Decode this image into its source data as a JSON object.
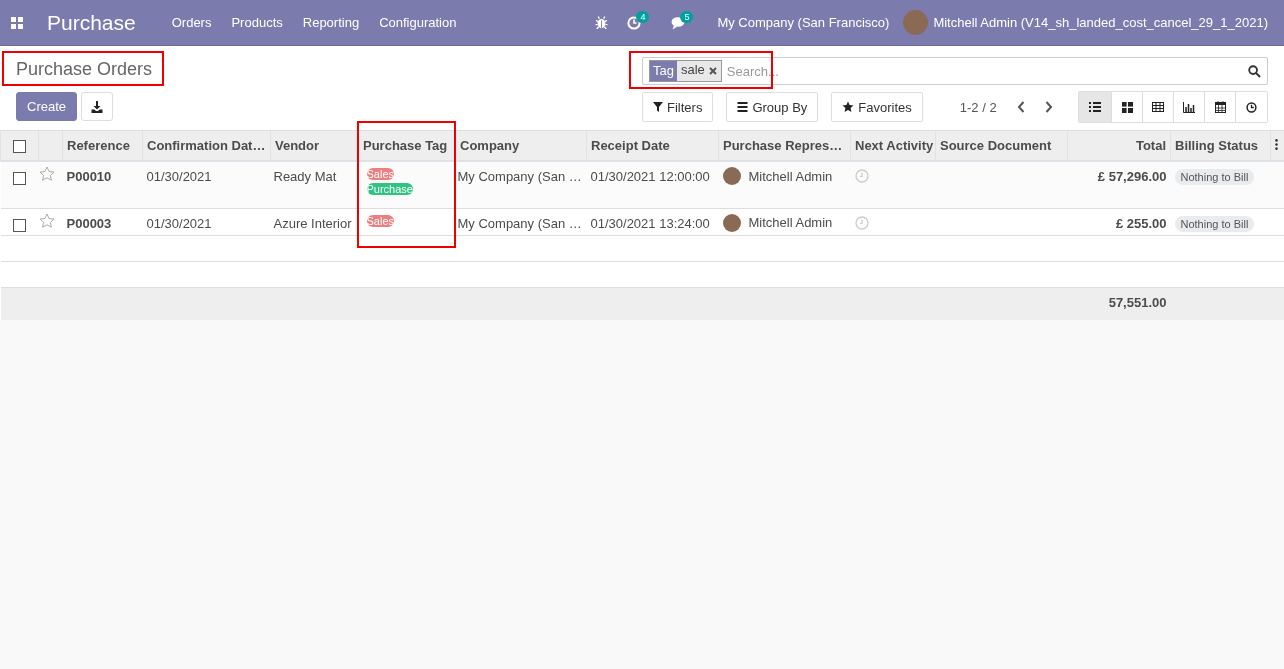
{
  "navbar": {
    "app_name": "Purchase",
    "menu": [
      "Orders",
      "Products",
      "Reporting",
      "Configuration"
    ],
    "activity_count": "4",
    "message_count": "5",
    "company": "My Company (San Francisco)",
    "user": "Mitchell Admin (V14_sh_landed_cost_cancel_29_1_2021)"
  },
  "breadcrumb": "Purchase Orders",
  "buttons": {
    "create": "Create"
  },
  "search": {
    "facet_label": "Tag",
    "facet_value": "sale",
    "placeholder": "Search..."
  },
  "search_options": [
    "Filters",
    "Group By",
    "Favorites"
  ],
  "pager": "1-2 / 2",
  "views": [
    {
      "kind": "list",
      "selected": true
    },
    {
      "kind": "kanban",
      "selected": false
    },
    {
      "kind": "pivot",
      "selected": false
    },
    {
      "kind": "graph",
      "selected": false
    },
    {
      "kind": "calendar",
      "selected": false
    },
    {
      "kind": "activity",
      "selected": false
    }
  ],
  "table": {
    "all_selected": false,
    "columns": [
      "Reference",
      "Confirmation Dat…",
      "Vendor",
      "Purchase Tag",
      "Company",
      "Receipt Date",
      "Purchase Repres…",
      "Next Activity",
      "Source Document",
      "Total",
      "Billing Status"
    ],
    "rows": [
      {
        "checked": false,
        "starred": false,
        "reference": "P00010",
        "confirmation_date": "01/30/2021",
        "vendor": "Ready Mat",
        "tags": [
          {
            "label": "Sales",
            "color": "#eb7e7f"
          },
          {
            "label": "Purchase",
            "color": "#30c381"
          }
        ],
        "company": "My Company (San …",
        "receipt_date": "01/30/2021 12:00:00",
        "representative": "Mitchell Admin",
        "total": "£ 57,296.00",
        "billing_status": "Nothing to Bill"
      },
      {
        "checked": false,
        "starred": false,
        "reference": "P00003",
        "confirmation_date": "01/30/2021",
        "vendor": "Azure Interior",
        "tags": [
          {
            "label": "Sales",
            "color": "#eb7e7f"
          }
        ],
        "company": "My Company (San …",
        "receipt_date": "01/30/2021 13:24:00",
        "representative": "Mitchell Admin",
        "total": "£ 255.00",
        "billing_status": "Nothing to Bill"
      }
    ],
    "footer_total": "57,551.00"
  }
}
